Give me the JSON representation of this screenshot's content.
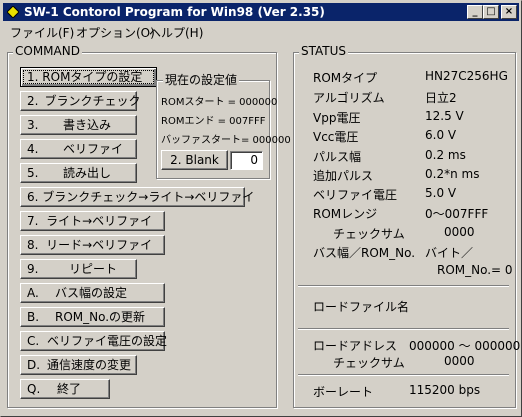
{
  "window": {
    "title": "SW-1 Contorol Program for Win98 (Ver 2.35)",
    "controls": [
      "_",
      "□",
      "×"
    ]
  },
  "menubar": [
    "ファイル(F)",
    "オプション(O)",
    "ヘルプ(H)"
  ],
  "command": {
    "title": "COMMAND",
    "buttons": {
      "b1": {
        "key": "1.",
        "label": "ROMタイプの設定"
      },
      "b2": {
        "key": "2.",
        "label": "ブランクチェック"
      },
      "b3": {
        "key": "3.",
        "label": "書き込み"
      },
      "b4": {
        "key": "4.",
        "label": "ベリファイ"
      },
      "b5": {
        "key": "5.",
        "label": "読み出し"
      },
      "b6": {
        "key": "6.",
        "label": "ブランクチェック→ライト→ベリファイ"
      },
      "b7": {
        "key": "7.",
        "label": "ライト→ベリファイ"
      },
      "b8": {
        "key": "8.",
        "label": "リード→ベリファイ"
      },
      "b9": {
        "key": "9.",
        "label": "リピート"
      },
      "bA": {
        "key": "A.",
        "label": "バス幅の設定"
      },
      "bB": {
        "key": "B.",
        "label": "ROM_No.の更新"
      },
      "bC": {
        "key": "C.",
        "label": "ベリファイ電圧の設定"
      },
      "bD": {
        "key": "D.",
        "label": "通信速度の変更"
      },
      "bQ": {
        "key": "Q.",
        "label": "終了"
      }
    },
    "current": {
      "title": "現在の設定値",
      "rom_start": "ROMスタート = 000000",
      "rom_end": "ROMエンド =   007FFF",
      "buffer_start": "バッファスタート= 000000",
      "blank_button": "2. Blank",
      "blank_value": "0"
    }
  },
  "status": {
    "title": "STATUS",
    "rom_type_label": "ROMタイプ",
    "rom_type_value": "HN27C256HG",
    "algorithm_label": "アルゴリズム",
    "algorithm_value": "日立2",
    "vpp_label": "Vpp電圧",
    "vpp_value": "12.5  V",
    "vcc_label": "Vcc電圧",
    "vcc_value": "6.0  V",
    "pulse_label": "パルス幅",
    "pulse_value": "0.2  ms",
    "add_pulse_label": "追加パルス",
    "add_pulse_value": "0.2*n  ms",
    "verify_v_label": "ベリファイ電圧",
    "verify_v_value": "5.0  V",
    "rom_range_label": "ROMレンジ",
    "rom_range_value": "0～007FFF",
    "checksum_label": "チェックサム",
    "checksum_value": "0000",
    "bus_label": "バス幅／ROM_No.",
    "bus_value": "バイト／",
    "rom_no_value": "ROM_No.=  0",
    "load_file_label": "ロードファイル名",
    "load_addr_label": "ロードアドレス",
    "load_addr_value": "000000 ～ 000000",
    "load_checksum_label": "チェックサム",
    "load_checksum_value": "0000",
    "baud_label": "ボーレート",
    "baud_value": "115200  bps"
  },
  "colors": {
    "titlebar": "#0a246a",
    "face": "#d4d0c8",
    "icon": "#e8e000"
  }
}
